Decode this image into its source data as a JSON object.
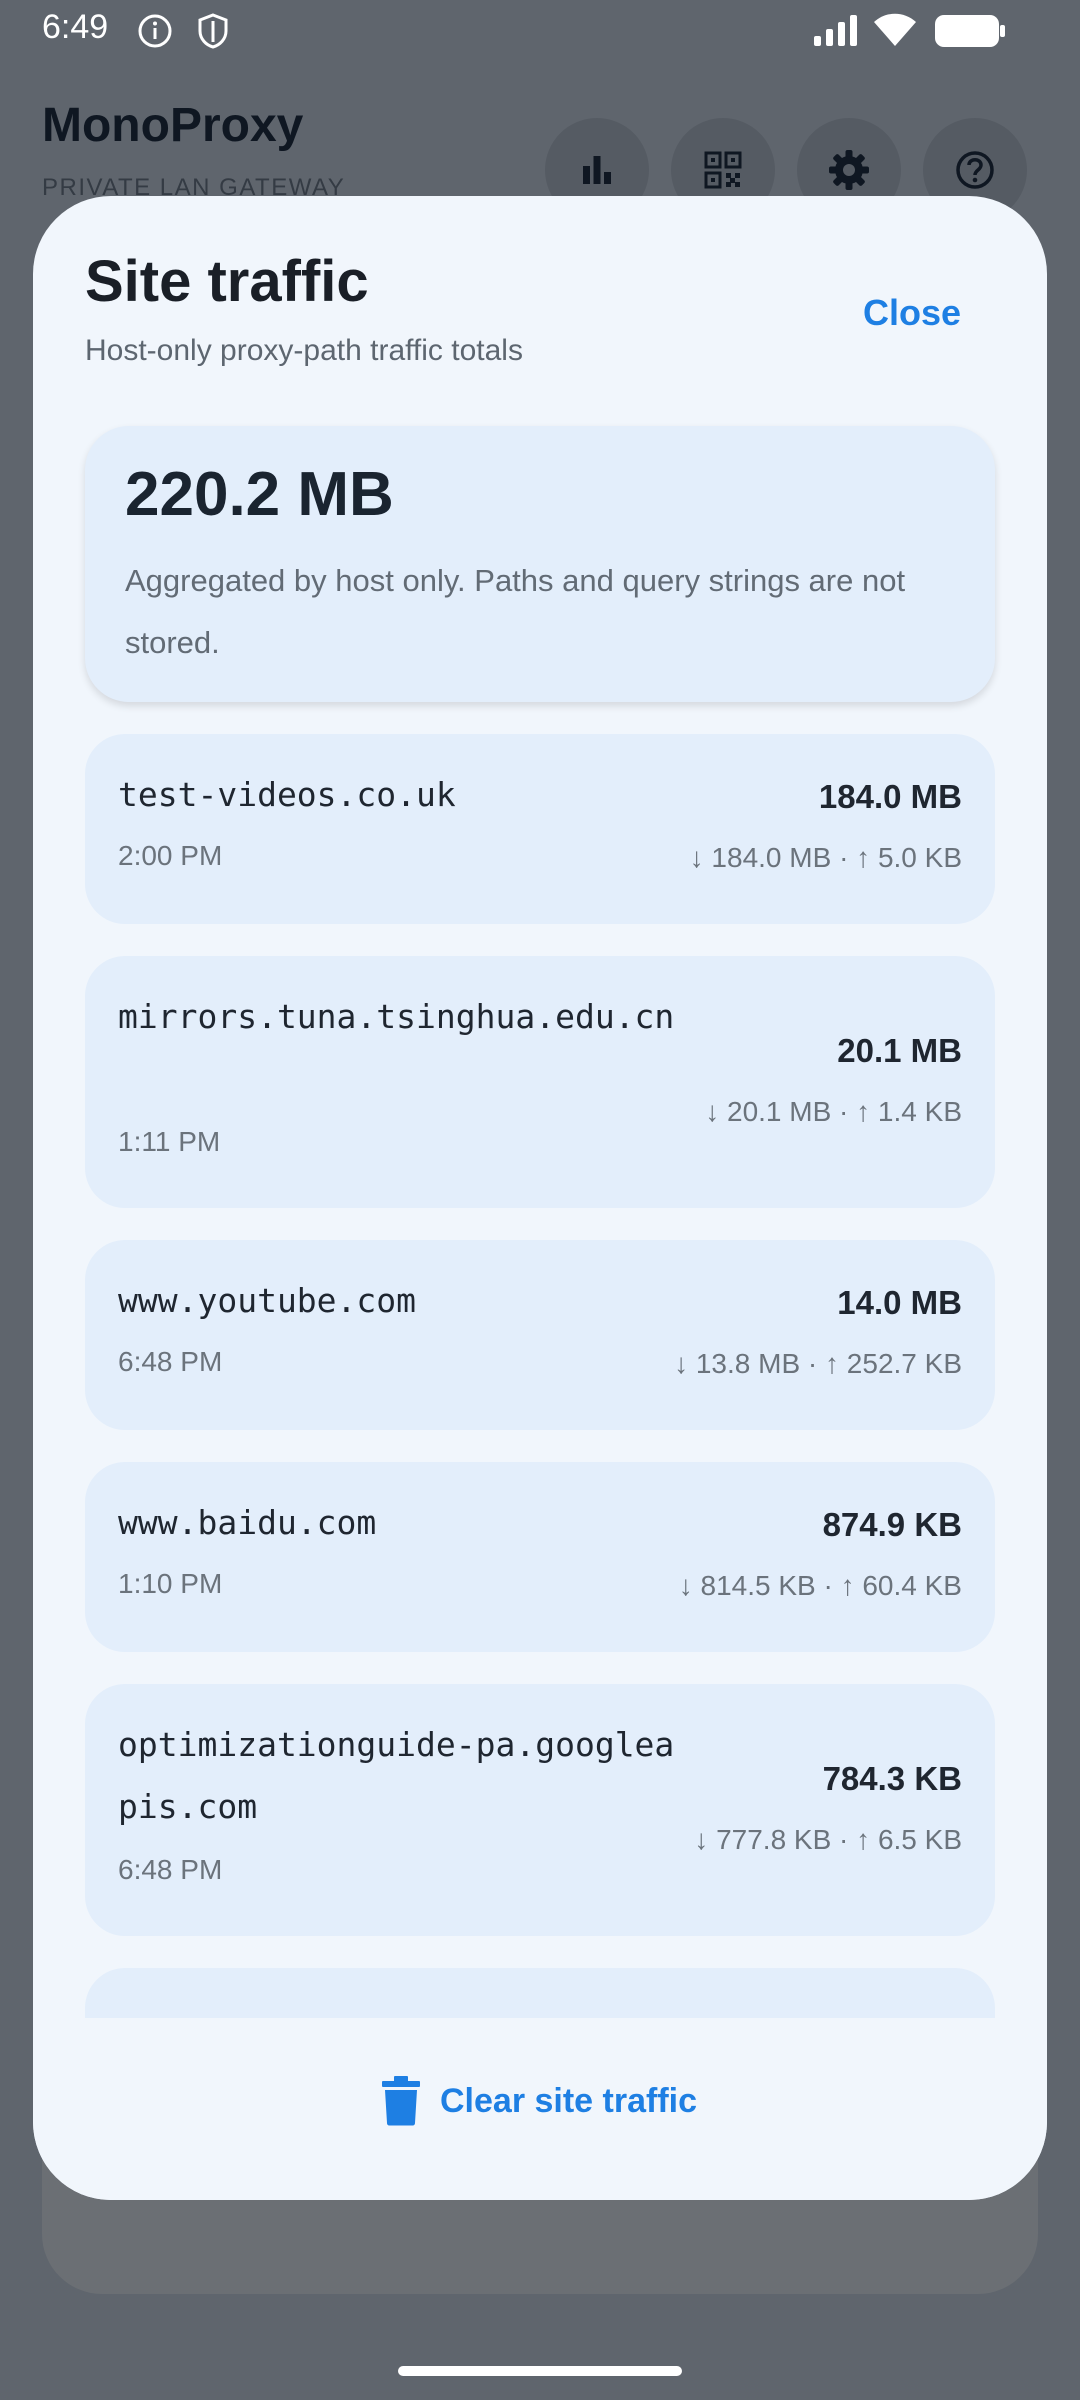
{
  "status_bar": {
    "time": "6:49",
    "icons": [
      "info-icon",
      "shield-icon",
      "signal-icon",
      "wifi-icon",
      "battery-icon"
    ]
  },
  "app": {
    "title": "MonoProxy",
    "subtitle": "PRIVATE LAN GATEWAY",
    "header_buttons": [
      "bar-chart-icon",
      "qr-code-icon",
      "gear-icon",
      "help-icon"
    ]
  },
  "sheet": {
    "title": "Site traffic",
    "subtitle": "Host-only proxy-path traffic totals",
    "close_label": "Close",
    "summary": {
      "total": "220.2 MB",
      "note": "Aggregated by host only. Paths and query strings are not stored."
    },
    "sites": [
      {
        "host": "test-videos.co.uk",
        "time": "2:00 PM",
        "total": "184.0 MB",
        "rates": "↓ 184.0 MB · ↑ 5.0 KB"
      },
      {
        "host": "mirrors.tuna.tsinghua.edu.cn",
        "time": "1:11 PM",
        "total": "20.1 MB",
        "rates": "↓ 20.1 MB · ↑ 1.4 KB"
      },
      {
        "host": "www.youtube.com",
        "time": "6:48 PM",
        "total": "14.0 MB",
        "rates": "↓ 13.8 MB · ↑ 252.7 KB"
      },
      {
        "host": "www.baidu.com",
        "time": "1:10 PM",
        "total": "874.9 KB",
        "rates": "↓ 814.5 KB · ↑ 60.4 KB"
      },
      {
        "host": "optimizationguide-pa.googleapis.com",
        "time": "6:48 PM",
        "total": "784.3 KB",
        "rates": "↓ 777.8 KB · ↑ 6.5 KB"
      }
    ],
    "clear_label": "Clear site traffic"
  },
  "colors": {
    "accent": "#1e7fe3",
    "sheet_bg": "#f1f6fc",
    "card_bg": "#e3eefb",
    "scrim": "#5f656d"
  }
}
